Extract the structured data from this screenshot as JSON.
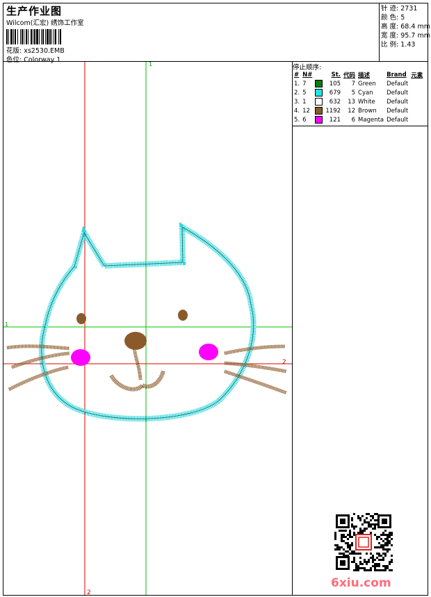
{
  "header": {
    "title": "生产作业图",
    "subtitle": "Wilcom(汇宏) 绣饰工作室",
    "pattern_label": "花版:",
    "pattern_value": "xs2530.EMB",
    "color_label": "色位:",
    "color_value": "Colorway 1"
  },
  "stats": {
    "stitches_label": "针 迹:",
    "stitches_value": "2731",
    "colors_label": "颜 色:",
    "colors_value": "5",
    "height_label": "高 度:",
    "height_value": "68.4 mm",
    "width_label": "宽 度:",
    "width_value": "95.7 mm",
    "scale_label": "比 例:",
    "scale_value": "1.43"
  },
  "stop_sequence": {
    "heading": "停止顺序:",
    "columns": [
      "#",
      "N#",
      "St.",
      "代码",
      "描述",
      "Brand",
      "元素"
    ],
    "rows": [
      {
        "idx": "1.",
        "n": "7",
        "color": "#0a7a0a",
        "st": "105",
        "code": "7",
        "desc": "Green",
        "brand": "Default"
      },
      {
        "idx": "2.",
        "n": "5",
        "color": "#22e4e4",
        "st": "679",
        "code": "5",
        "desc": "Cyan",
        "brand": "Default"
      },
      {
        "idx": "3.",
        "n": "1",
        "color": "#ffffff",
        "st": "632",
        "code": "13",
        "desc": "White",
        "brand": "Default"
      },
      {
        "idx": "4.",
        "n": "12",
        "color": "#8b5a2b",
        "st": "1192",
        "code": "12",
        "desc": "Brown",
        "brand": "Default"
      },
      {
        "idx": "5.",
        "n": "6",
        "color": "#ff00ff",
        "st": "121",
        "code": "6",
        "desc": "Magenta",
        "brand": "Default"
      }
    ]
  },
  "guides": {
    "green_top": "1",
    "green_left": "1",
    "red_right": "2",
    "red_bottom": "2"
  },
  "brand_logo": "6xiu.com",
  "palette": {
    "cyan": "#30d8e0",
    "brown": "#8b5a2b",
    "magenta": "#ff00ff",
    "red_guide": "#e00000",
    "green_guide": "#00c000"
  }
}
